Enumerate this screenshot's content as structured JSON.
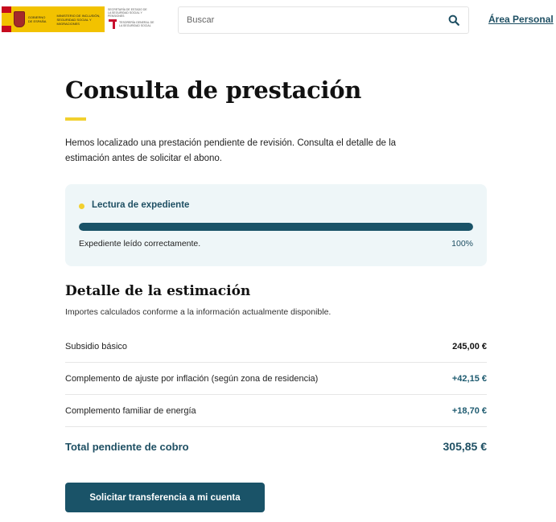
{
  "header": {
    "logo": {
      "gov_text": "GOBIERNO DE ESPAÑA",
      "ministry_text": "MINISTERIO DE INCLUSIÓN, SEGURIDAD SOCIAL Y MIGRACIONES",
      "ss_top_text": "SECRETARÍA DE ESTADO DE LA SEGURIDAD SOCIAL Y PENSIONES",
      "ss_text": "TESORERÍA GENERAL DE LA SEGURIDAD SOCIAL"
    },
    "search": {
      "placeholder": "Buscar",
      "icon": "search-icon"
    },
    "area_link": "Área Personal"
  },
  "page": {
    "title": "Consulta de prestación",
    "intro": "Hemos localizado una prestación pendiente de revisión. Consulta el detalle de la estimación antes de solicitar el abono."
  },
  "progress": {
    "title": "Lectura de expediente",
    "status": "Expediente leído correctamente.",
    "percent_label": "100%",
    "value": 1.0
  },
  "estimate": {
    "title": "Detalle de la estimación",
    "subtitle": "Importes calculados conforme a la información actualmente disponible.",
    "rows": [
      {
        "label": "Subsidio básico",
        "value": "245,00 €",
        "kind": "base"
      },
      {
        "label": "Complemento de ajuste por inflación (según zona de residencia)",
        "value": "+42,15 €",
        "kind": "plus"
      },
      {
        "label": "Complemento familiar de energía",
        "value": "+18,70 €",
        "kind": "plus"
      }
    ],
    "total_label": "Total pendiente de cobro",
    "total_value": "305,85 €"
  },
  "cta": {
    "label": "Solicitar transferencia a mi cuenta"
  },
  "colors": {
    "accent_yellow": "#f2d02e",
    "primary": "#1a5368",
    "card_bg": "#eef6f8"
  }
}
